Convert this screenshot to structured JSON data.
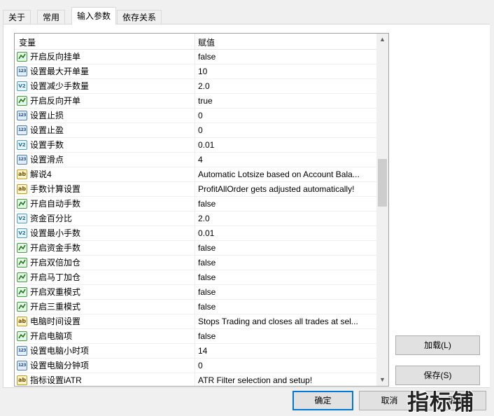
{
  "tabs": [
    {
      "label": "关于"
    },
    {
      "label": "常用"
    },
    {
      "label": "输入参数"
    },
    {
      "label": "依存关系"
    }
  ],
  "grid": {
    "header": {
      "variable": "变量",
      "value": "赋值"
    },
    "rows": [
      {
        "type": "bool",
        "icon": "bool-icon",
        "name": "开启反向挂单",
        "value": "false"
      },
      {
        "type": "int",
        "icon": "int-icon",
        "name": "设置最大开单量",
        "value": "10"
      },
      {
        "type": "dbl",
        "icon": "double-icon",
        "name": "设置减少手数量",
        "value": "2.0"
      },
      {
        "type": "bool",
        "icon": "bool-icon",
        "name": "开启反向开单",
        "value": "true"
      },
      {
        "type": "int",
        "icon": "int-icon",
        "name": "设置止损",
        "value": "0"
      },
      {
        "type": "int",
        "icon": "int-icon",
        "name": "设置止盈",
        "value": "0"
      },
      {
        "type": "dbl",
        "icon": "double-icon",
        "name": "设置手数",
        "value": "0.01"
      },
      {
        "type": "int",
        "icon": "int-icon",
        "name": "设置滑点",
        "value": "4"
      },
      {
        "type": "str",
        "icon": "string-icon",
        "name": "解说4",
        "value": "Automatic Lotsize based on Account Bala..."
      },
      {
        "type": "str",
        "icon": "string-icon",
        "name": "手数计算设置",
        "value": "ProfitAllOrder gets adjusted automatically!"
      },
      {
        "type": "bool",
        "icon": "bool-icon",
        "name": "开启自动手数",
        "value": "false"
      },
      {
        "type": "dbl",
        "icon": "double-icon",
        "name": "资金百分比",
        "value": "2.0"
      },
      {
        "type": "dbl",
        "icon": "double-icon",
        "name": "设置最小手数",
        "value": "0.01"
      },
      {
        "type": "bool",
        "icon": "bool-icon",
        "name": "开启资金手数",
        "value": "false"
      },
      {
        "type": "bool",
        "icon": "bool-icon",
        "name": "开启双倍加仓",
        "value": "false"
      },
      {
        "type": "bool",
        "icon": "bool-icon",
        "name": "开启马丁加仓",
        "value": "false"
      },
      {
        "type": "bool",
        "icon": "bool-icon",
        "name": "开启双重模式",
        "value": "false"
      },
      {
        "type": "bool",
        "icon": "bool-icon",
        "name": "开启三重模式",
        "value": "false"
      },
      {
        "type": "str",
        "icon": "string-icon",
        "name": "电脑时间设置",
        "value": "Stops Trading and closes all trades at sel..."
      },
      {
        "type": "bool",
        "icon": "bool-icon",
        "name": "开启电脑项",
        "value": "false"
      },
      {
        "type": "int",
        "icon": "int-icon",
        "name": "设置电脑小时项",
        "value": "14"
      },
      {
        "type": "int",
        "icon": "int-icon",
        "name": "设置电脑分钟项",
        "value": "0"
      },
      {
        "type": "str",
        "icon": "string-icon",
        "name": "指标设置iATR",
        "value": "ATR Filter selection and setup!"
      }
    ]
  },
  "icon_glyphs": {
    "int": "123",
    "dbl": "V2",
    "str": "ab"
  },
  "buttons": {
    "load": "加载(L)",
    "save": "保存(S)",
    "ok": "确定",
    "cancel": "取消",
    "reset": "重设"
  },
  "watermark": "指标铺"
}
